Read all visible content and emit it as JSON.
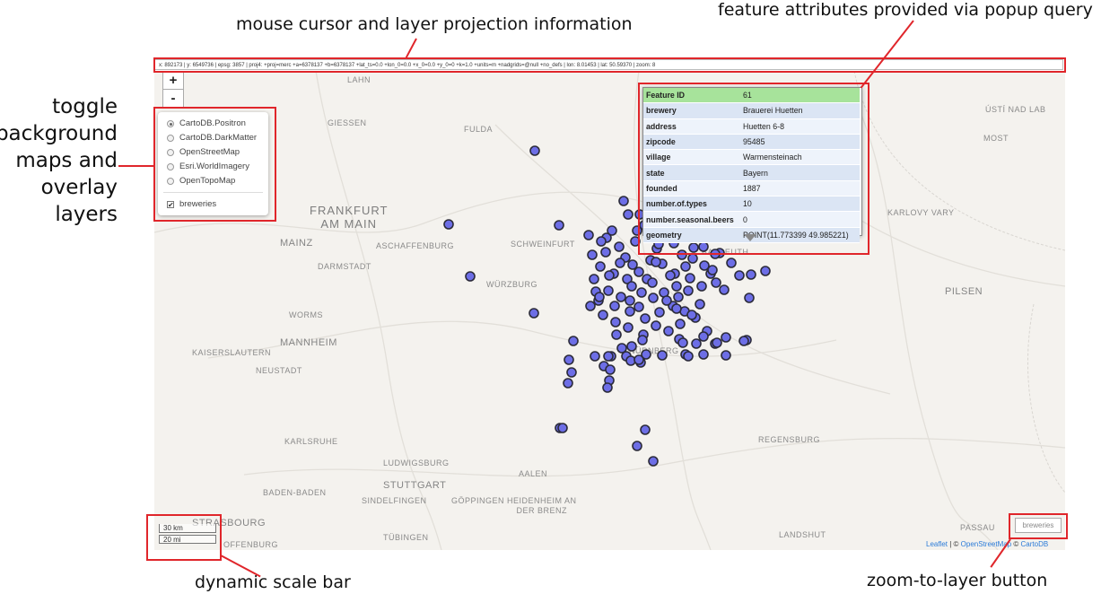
{
  "annotations": {
    "top_left": "mouse cursor and layer projection information",
    "top_right": "feature attributes provided via popup query",
    "left_lines": [
      "toggle",
      "background",
      "maps and",
      "overlay",
      "layers"
    ],
    "bottom_left": "dynamic scale bar",
    "bottom_right": "zoom-to-layer button"
  },
  "coord_bar": "x: 892173 | y: 6549736 | epsg: 3857 | proj4: +proj=merc +a=6378137 +b=6378137 +lat_ts=0.0 +lon_0=0.0 +x_0=0.0 +y_0=0 +k=1.0 +units=m +nadgrids=@null +no_defs | lon: 8.01453 | lat: 50.59370 | zoom: 8",
  "zoom": {
    "in": "+",
    "out": "-"
  },
  "layers": {
    "base": [
      "CartoDB.Positron",
      "CartoDB.DarkMatter",
      "OpenStreetMap",
      "Esri.WorldImagery",
      "OpenTopoMap"
    ],
    "selected": "CartoDB.Positron",
    "overlay": "breweries"
  },
  "popup": {
    "header_key": "Feature ID",
    "header_val": "61",
    "rows": [
      [
        "brewery",
        "Brauerei Huetten"
      ],
      [
        "address",
        "Huetten 6-8"
      ],
      [
        "zipcode",
        "95485"
      ],
      [
        "village",
        "Warmensteinach"
      ],
      [
        "state",
        "Bayern"
      ],
      [
        "founded",
        "1887"
      ],
      [
        "number.of.types",
        "10"
      ],
      [
        "number.seasonal.beers",
        "0"
      ],
      [
        "geometry",
        "POINT(11.773399 49.985221)"
      ]
    ]
  },
  "scale": {
    "km": "30 km",
    "mi": "20 mi"
  },
  "zoom_layer_button": "breweries",
  "attribution": {
    "leaflet": "Leaflet",
    "sep": " | © ",
    "osm": "OpenStreetMap",
    "sep2": " © ",
    "carto": "CartoDB"
  },
  "cities": {
    "lahn": "LAHN",
    "giessen": "GIESSEN",
    "fulda": "FULDA",
    "frankfurt": "FRANKFURT\nAM MAIN",
    "mainz": "MAINZ",
    "aschaffenburg": "ASCHAFFENBURG",
    "schweinfurt": "SCHWEINFURT",
    "darmstadt": "DARMSTADT",
    "wurzburg": "WÜRZBURG",
    "worms": "WORMS",
    "mannheim": "MANNHEIM",
    "kaiserslautern": "KAISERSLAUTERN",
    "neustadt": "NEUSTADT",
    "nurnberg": "NÜRNBERG",
    "karlsruhe": "KARLSRUHE",
    "ludwigsburg": "LUDWIGSBURG",
    "aalen": "AALEN",
    "stuttgart": "STUTTGART",
    "sindelfingen": "SINDELFINGEN",
    "goppingen": "GÖPPINGEN",
    "heidenheim": "HEIDENHEIM AN\nDER BRENZ",
    "baden": "BADEN-BADEN",
    "strasbourg": "STRASBOURG",
    "offenburg": "OFFENBURG",
    "tubingen": "TÜBINGEN",
    "regensburg": "REGENSBURG",
    "landshut": "LANDSHUT",
    "passau": "PASSAU",
    "pilsen": "PILSEN",
    "karlovy": "KARLOVY VARY",
    "most": "MOST",
    "usti": "ÚSTÍ NAD LAB",
    "bayreuth": "BAYREUTH"
  }
}
